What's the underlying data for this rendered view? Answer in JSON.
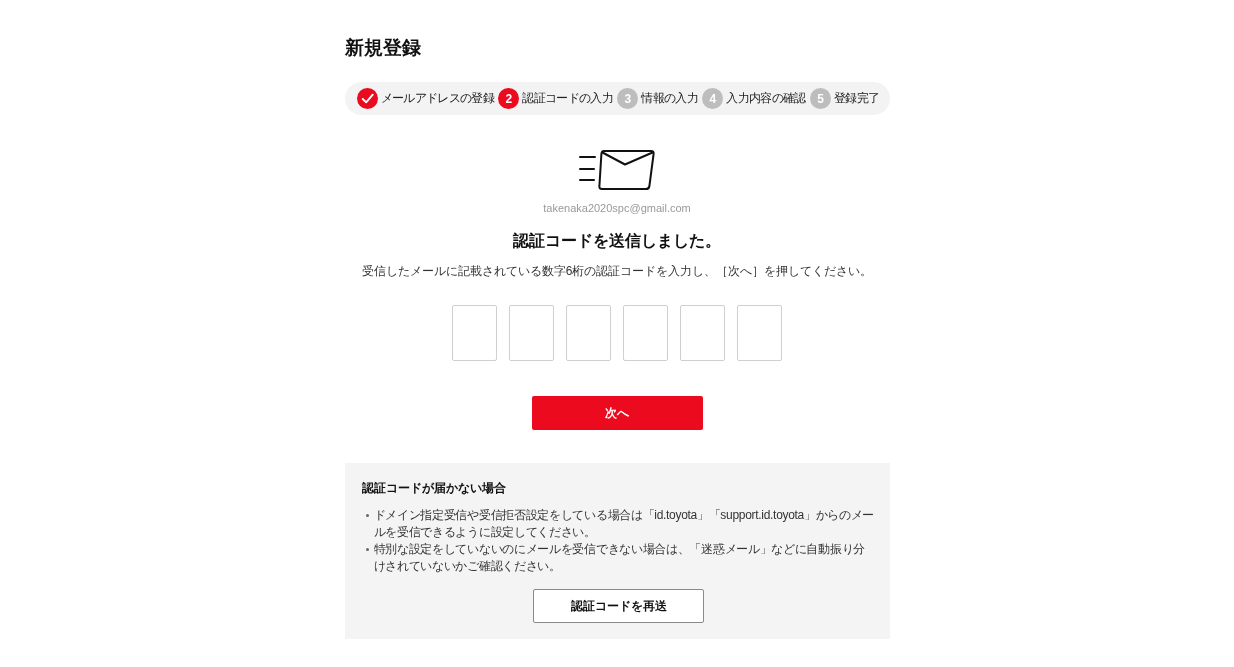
{
  "page_title": "新規登録",
  "steps": [
    {
      "kind": "completed",
      "label": "メールアドレスの登録"
    },
    {
      "kind": "current",
      "number": "2",
      "label": "認証コードの入力"
    },
    {
      "kind": "upcoming",
      "number": "3",
      "label": "情報の入力"
    },
    {
      "kind": "upcoming",
      "number": "4",
      "label": "入力内容の確認"
    },
    {
      "kind": "upcoming",
      "number": "5",
      "label": "登録完了"
    }
  ],
  "email": "takenaka2020spc@gmail.com",
  "heading": "認証コードを送信しました。",
  "instructions": "受信したメールに記載されている数字6桁の認証コードを入力し、［次へ］を押してください。",
  "code_fields": [
    {
      "focused": false
    },
    {
      "focused": false
    },
    {
      "focused": false
    },
    {
      "focused": false
    },
    {
      "focused": false
    },
    {
      "focused": false
    }
  ],
  "next_button": "次へ",
  "help_panel": {
    "title": "認証コードが届かない場合",
    "items": [
      "ドメイン指定受信や受信拒否設定をしている場合は「id.toyota」「support.id.toyota」からのメールを受信できるように設定してください。",
      "特別な設定をしていないのにメールを受信できない場合は、「迷惑メール」などに自動振り分けされていないかご確認ください。"
    ],
    "resend_button": "認証コードを再送"
  }
}
